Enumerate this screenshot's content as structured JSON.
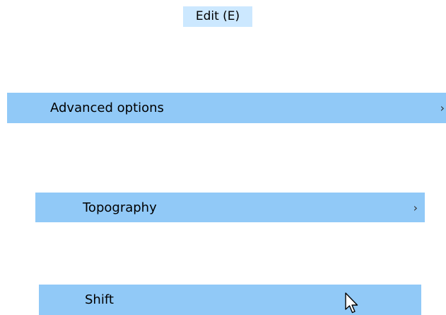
{
  "menu": {
    "title": "Edit (E)",
    "items": [
      {
        "label": "Advanced options",
        "has_submenu": true
      },
      {
        "label": "Topography",
        "has_submenu": true
      },
      {
        "label": "Shift",
        "has_submenu": false
      }
    ]
  },
  "icons": {
    "submenu": "chevron-right-icon",
    "cursor": "mouse-pointer-icon"
  },
  "colors": {
    "highlight": "#91c9f7",
    "title_highlight": "#cce8ff",
    "background": "#ffffff"
  }
}
